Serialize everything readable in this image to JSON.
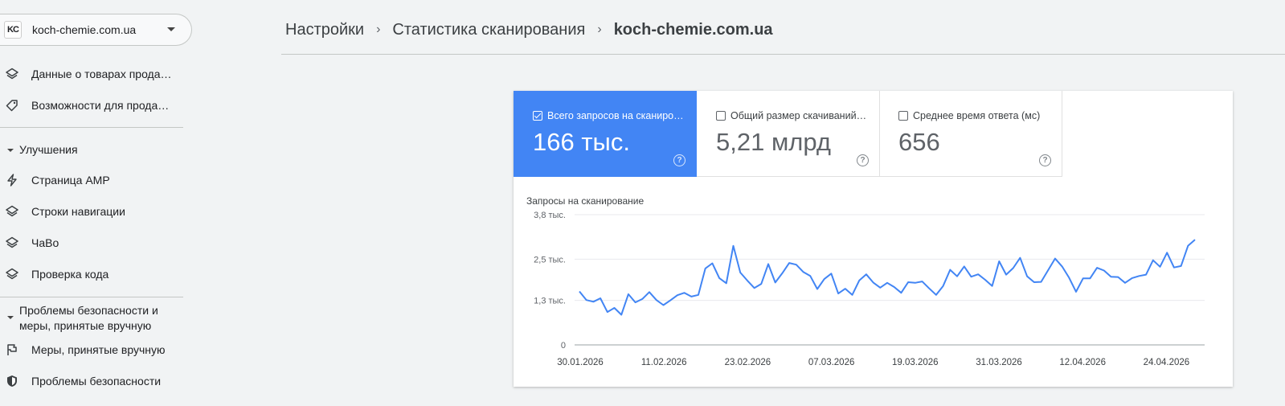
{
  "property": {
    "logo": "KC",
    "name": "koch-chemie.com.ua"
  },
  "sidebar": {
    "items": [
      {
        "label": "Данные о товарах продавца",
        "icon": "layers-icon"
      },
      {
        "label": "Возможности для продавцов",
        "icon": "tag-icon"
      }
    ],
    "section1": "Улучшения",
    "section1_items": [
      {
        "label": "Страница AMP",
        "icon": "bolt-icon"
      },
      {
        "label": "Строки навигации",
        "icon": "layers-icon"
      },
      {
        "label": "ЧаВо",
        "icon": "layers-icon"
      },
      {
        "label": "Проверка кода",
        "icon": "layers-icon"
      }
    ],
    "section2_line1": "Проблемы безопасности и",
    "section2_line2": "меры, принятые вручную",
    "section2_items": [
      {
        "label": "Меры, принятые вручную",
        "icon": "flag-icon"
      },
      {
        "label": "Проблемы безопасности",
        "icon": "shield-icon"
      }
    ]
  },
  "breadcrumb": {
    "items": [
      "Настройки",
      "Статистика сканирования"
    ],
    "current": "koch-chemie.com.ua",
    "separator": "›"
  },
  "metrics": [
    {
      "label": "Всего запросов на сканирование",
      "value": "166 тыс.",
      "checked": true
    },
    {
      "label": "Общий размер скачиваний (байт)",
      "value": "5,21 млрд",
      "checked": false
    },
    {
      "label": "Среднее время ответа (мс)",
      "value": "656",
      "checked": false
    }
  ],
  "help_glyph": "?",
  "colors": {
    "accent": "#4285f4",
    "line": "#4285f4"
  },
  "chart_data": {
    "type": "line",
    "title": "Запросы на сканирование",
    "ylim": [
      0,
      3800
    ],
    "y_ticks": [
      0,
      1300,
      2500,
      3800
    ],
    "y_tick_labels": [
      "0",
      "1,3 тыс.",
      "2,5 тыс.",
      "3,8 тыс."
    ],
    "x_tick_labels": [
      "30.01.2026",
      "11.02.2026",
      "23.02.2026",
      "07.03.2026",
      "19.03.2026",
      "31.03.2026",
      "12.04.2026",
      "24.04.2026"
    ],
    "x_start": "2026-01-30",
    "x_end": "2026-04-28",
    "grid": true,
    "series": [
      {
        "values": [
          1560,
          1310,
          1260,
          1360,
          960,
          1080,
          880,
          1480,
          1240,
          1340,
          1540,
          1310,
          1160,
          1300,
          1450,
          1520,
          1410,
          1460,
          2230,
          2380,
          1950,
          1800,
          2890,
          2110,
          1880,
          1660,
          1780,
          2360,
          1820,
          2090,
          2390,
          2340,
          2130,
          2010,
          1630,
          1920,
          2080,
          1500,
          1640,
          1460,
          1880,
          2060,
          1820,
          1670,
          1810,
          1690,
          1520,
          1830,
          1810,
          1850,
          1650,
          1460,
          1720,
          2190,
          2000,
          2290,
          1990,
          2060,
          1900,
          1720,
          2440,
          2050,
          2240,
          2540,
          2000,
          1830,
          1840,
          2180,
          2520,
          2290,
          1960,
          1550,
          1940,
          1940,
          2250,
          2170,
          1990,
          1980,
          1810,
          1950,
          2010,
          2050,
          2470,
          2280,
          2690,
          2260,
          2300,
          2890,
          3070
        ]
      }
    ]
  }
}
